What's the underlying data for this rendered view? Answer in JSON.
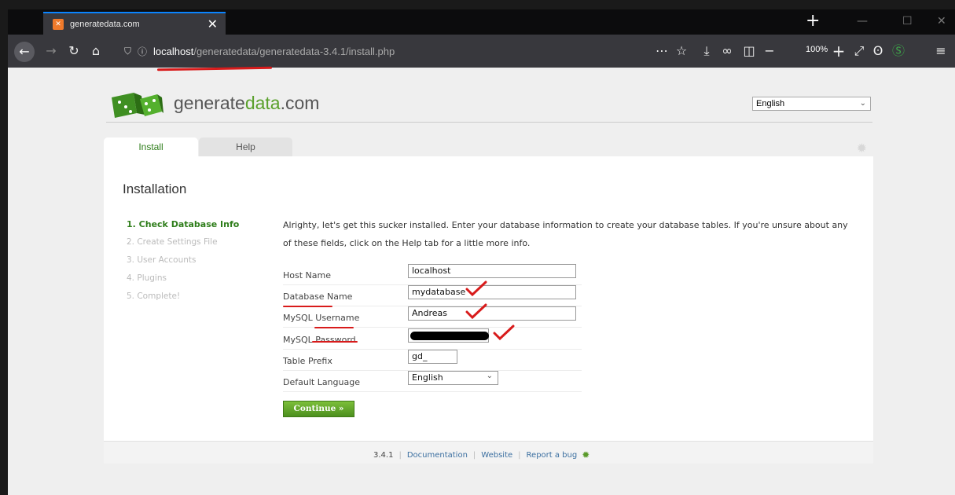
{
  "browser": {
    "tab_title": "generatedata.com",
    "tab_close": "✕",
    "new_tab": "+",
    "url_host": "localhost",
    "url_path": "/generatedata/generatedata-3.4.1/install.php",
    "zoom": "100%"
  },
  "site": {
    "logo_text_main": "generate",
    "logo_text_accent": "data",
    "logo_text_suffix": ".com",
    "language": "English"
  },
  "tabs": [
    {
      "label": "Install"
    },
    {
      "label": "Help"
    }
  ],
  "install": {
    "title": "Installation",
    "steps": [
      "1. Check Database Info",
      "2. Create Settings File",
      "3. User Accounts",
      "4. Plugins",
      "5. Complete!"
    ],
    "intro": "Alrighty, let's get this sucker installed. Enter your database information to create your database tables. If you're unsure about any of these fields, click on the Help tab for a little more info.",
    "fields": {
      "host_label": "Host Name",
      "host_value": "localhost",
      "dbname_label": "Database Name",
      "dbname_value": "mydatabase",
      "user_label": "MySQL Username",
      "user_value": "Andreas",
      "password_label": "MySQL Password",
      "prefix_label": "Table Prefix",
      "prefix_value": "gd_",
      "lang_label": "Default Language",
      "lang_value": "English"
    },
    "continue_label": "Continue »"
  },
  "footer": {
    "version": "3.4.1",
    "documentation": "Documentation",
    "website": "Website",
    "report_bug": "Report a bug"
  },
  "annotation_color": "#d81b1b",
  "accent_green": "#5aa02c"
}
